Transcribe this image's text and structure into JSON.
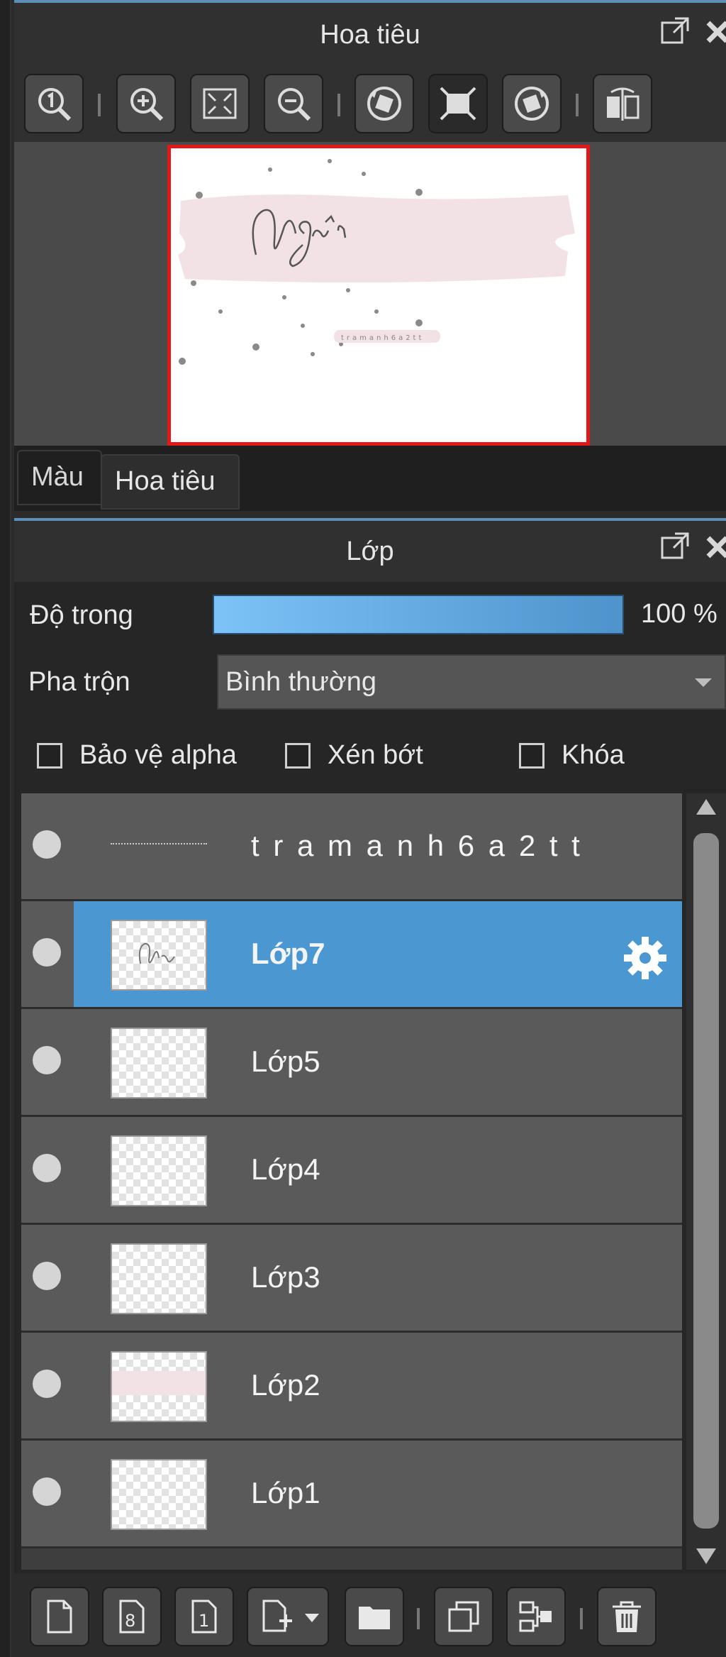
{
  "navigator": {
    "title": "Hoa tiêu",
    "toolbar_icons": [
      "zoom-actual-icon",
      "zoom-in-icon",
      "fit-icon",
      "zoom-out-icon",
      "rotate-left-icon",
      "fit-window-icon",
      "rotate-right-icon",
      "flip-icon"
    ],
    "preview_text": "Ngân",
    "tabs": [
      {
        "label": "Màu",
        "active": false
      },
      {
        "label": "Hoa tiêu",
        "active": true
      }
    ]
  },
  "layers_panel": {
    "title": "Lớp",
    "opacity_label": "Độ trong",
    "opacity_value": "100 %",
    "opacity_percent": 100,
    "blend_label": "Pha trộn",
    "blend_mode": "Bình thường",
    "checkboxes": [
      {
        "label": "Bảo vệ alpha",
        "checked": false
      },
      {
        "label": "Xén bớt",
        "checked": false
      },
      {
        "label": "Khóa",
        "checked": false
      }
    ],
    "layers": [
      {
        "name": "t r a m a n h 6 a 2 t t",
        "selected": false
      },
      {
        "name": "Lớp7",
        "selected": true
      },
      {
        "name": "Lớp5",
        "selected": false
      },
      {
        "name": "Lớp4",
        "selected": false
      },
      {
        "name": "Lớp3",
        "selected": false
      },
      {
        "name": "Lớp2",
        "selected": false
      },
      {
        "name": "Lớp1",
        "selected": false
      }
    ],
    "bottom_icons": [
      "new-layer-icon",
      "new-8bit-layer-icon",
      "new-1bit-layer-icon",
      "add-layer-menu-icon",
      "folder-icon",
      "duplicate-icon",
      "merge-icon",
      "delete-icon"
    ]
  },
  "colors": {
    "accent": "#4a97d1",
    "preview_border": "#e21818",
    "brush_pink": "#f2e1e5"
  }
}
